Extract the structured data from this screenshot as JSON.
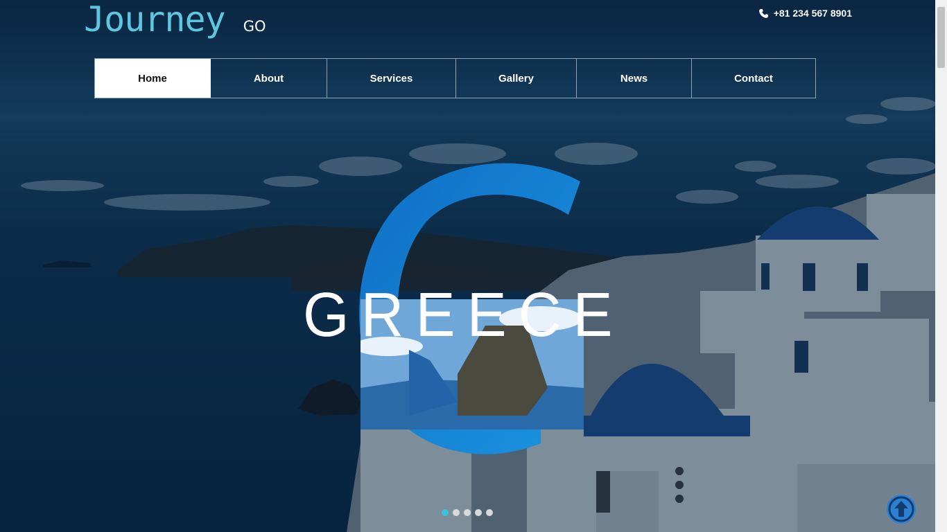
{
  "header": {
    "logo_text": "Journey",
    "logo_suffix": "GO",
    "phone": "+81 234 567 8901",
    "phone_icon": "phone-icon"
  },
  "nav": {
    "items": [
      {
        "label": "Home",
        "active": true
      },
      {
        "label": "About",
        "active": false
      },
      {
        "label": "Services",
        "active": false
      },
      {
        "label": "Gallery",
        "active": false
      },
      {
        "label": "News",
        "active": false
      },
      {
        "label": "Contact",
        "active": false
      }
    ]
  },
  "hero": {
    "title": "GREECE",
    "accent_color": "#1a86d6",
    "slides_total": 5,
    "active_slide": 1
  },
  "back_to_top_icon": "arrow-up-icon",
  "colors": {
    "logo": "#5fc7dd",
    "dot_active": "#35c4dc",
    "to_top": "#2f7fd0"
  }
}
